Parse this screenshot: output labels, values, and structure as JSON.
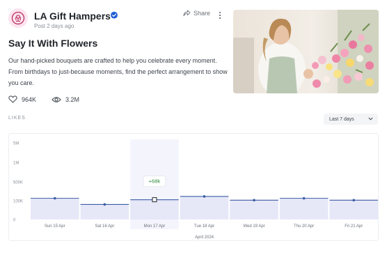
{
  "post": {
    "brand_name": "LA Gift Hampers",
    "post_time": "Post 2 days ago",
    "share_label": "Share",
    "title": "Say It With Flowers",
    "description": "Our hand-picked bouquets are crafted to help you celebrate every moment. From birthdays to just-because moments, find the perfect arrangement to show you care.",
    "likes_count": "964K",
    "views_count": "3.2M"
  },
  "section": {
    "likes_label": "LIKES",
    "range_selected": "Last 7 days"
  },
  "colors": {
    "accent": "#3b5ba5",
    "fill": "#e6e8f8",
    "highlight": "#f4f4fd",
    "badge": "#2f8a3a",
    "brand": "#b83264",
    "verified": "#1d5bd6"
  },
  "chart_data": {
    "type": "area",
    "title": "",
    "xlabel": "April 2024",
    "ylabel": "",
    "categories": [
      "Sun 15 Apr",
      "Sat 16 Apr",
      "Mon 17 Apr",
      "Tue 18 Apr",
      "Wed 19 Apr",
      "Thu 20 Apr",
      "Fri 21 Apr"
    ],
    "y_ticks": [
      "5M",
      "1M",
      "500K",
      "100K",
      "0"
    ],
    "values": [
      150000,
      80000,
      120000,
      190000,
      110000,
      150000,
      110000
    ],
    "highlighted_index": 2,
    "tooltip": "+68k",
    "grid": true
  }
}
